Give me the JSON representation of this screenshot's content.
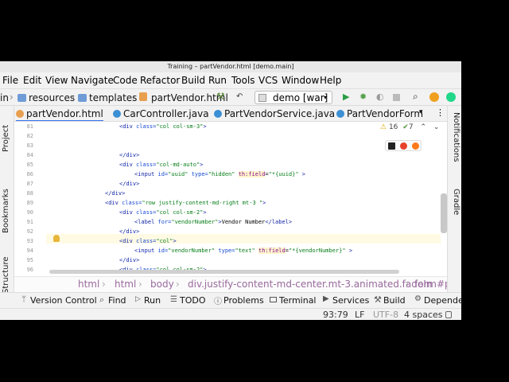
{
  "window": {
    "title": "Training – partVendor.html [demo.main]"
  },
  "menu": [
    "File",
    "Edit",
    "View",
    "Navigate",
    "Code",
    "Refactor",
    "Build",
    "Run",
    "Tools",
    "VCS",
    "Window",
    "Help"
  ],
  "nav": {
    "crumbs": [
      "in",
      "resources",
      "templates",
      "partVendor.html"
    ],
    "run_config": "demo [war]"
  },
  "left_tools": [
    "Project",
    "Bookmarks",
    "Structure"
  ],
  "right_tools": [
    "Notifications",
    "Gradle"
  ],
  "tabs": [
    "partVendor.html",
    "CarController.java",
    "PartVendorService.java",
    "PartVendorForm"
  ],
  "inspections": {
    "warnings": "16",
    "weak_warnings": "7"
  },
  "line_numbers": [
    "81",
    "82",
    "83",
    "84",
    "85",
    "86",
    "87",
    "88",
    "89",
    "90",
    "91",
    "92",
    "93",
    "94",
    "95",
    "96"
  ],
  "breadcrumb": [
    "html",
    "html",
    "body",
    "div.justify-content-md-center.mt-3.animated.fadeIn",
    "form#p"
  ],
  "tool_windows": [
    "Version Control",
    "Find",
    "Run",
    "TODO",
    "Problems",
    "Terminal",
    "Services",
    "Build",
    "Dependenc"
  ],
  "status": {
    "position": "93:79",
    "line_sep": "LF",
    "encoding": "UTF-8",
    "indent": "4 spaces"
  }
}
